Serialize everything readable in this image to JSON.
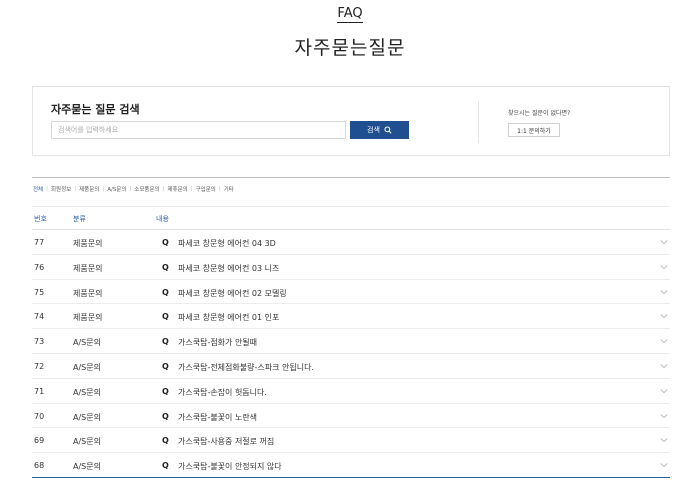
{
  "header": {
    "faq_label": "FAQ",
    "title": "자주묻는질문"
  },
  "search": {
    "title": "자주묻는 질문 검색",
    "placeholder": "검색어를 입력하세요",
    "button_label": "검색",
    "ask_text": "찾으시는 질문이 없다면?",
    "ask_button": "1:1 문의하기"
  },
  "categories": [
    "전체",
    "회원정보",
    "제품문의",
    "A/S문의",
    "소모품문의",
    "제휴문의",
    "구입문의",
    "기타"
  ],
  "table": {
    "headers": {
      "no": "번호",
      "category": "분류",
      "content": "내용"
    },
    "q_mark": "Q",
    "rows": [
      {
        "no": "77",
        "category": "제품문의",
        "subject": "파세코 창문형 에어컨 04 3D"
      },
      {
        "no": "76",
        "category": "제품문의",
        "subject": "파세코 창문형 에어컨 03 니즈"
      },
      {
        "no": "75",
        "category": "제품문의",
        "subject": "파세코 창문형 에어컨 02 모델링"
      },
      {
        "no": "74",
        "category": "제품문의",
        "subject": "파세코 창문형 에어컨 01 인포"
      },
      {
        "no": "73",
        "category": "A/S문의",
        "subject": "가스쿡탑-점화가 안될때"
      },
      {
        "no": "72",
        "category": "A/S문의",
        "subject": "가스쿡탑-전체점화불량-스파크 안됩니다."
      },
      {
        "no": "71",
        "category": "A/S문의",
        "subject": "가스쿡탑-손잡이 헛돕니다."
      },
      {
        "no": "70",
        "category": "A/S문의",
        "subject": "가스쿡탑-불꽃이 노란색"
      },
      {
        "no": "69",
        "category": "A/S문의",
        "subject": "가스쿡탑-사용중 저절로 꺼짐"
      },
      {
        "no": "68",
        "category": "A/S문의",
        "subject": "가스쿡탑-불꽃이 안정되지 않다"
      }
    ]
  },
  "colors": {
    "accent": "#1f4e91",
    "link": "#2a5fa8"
  }
}
